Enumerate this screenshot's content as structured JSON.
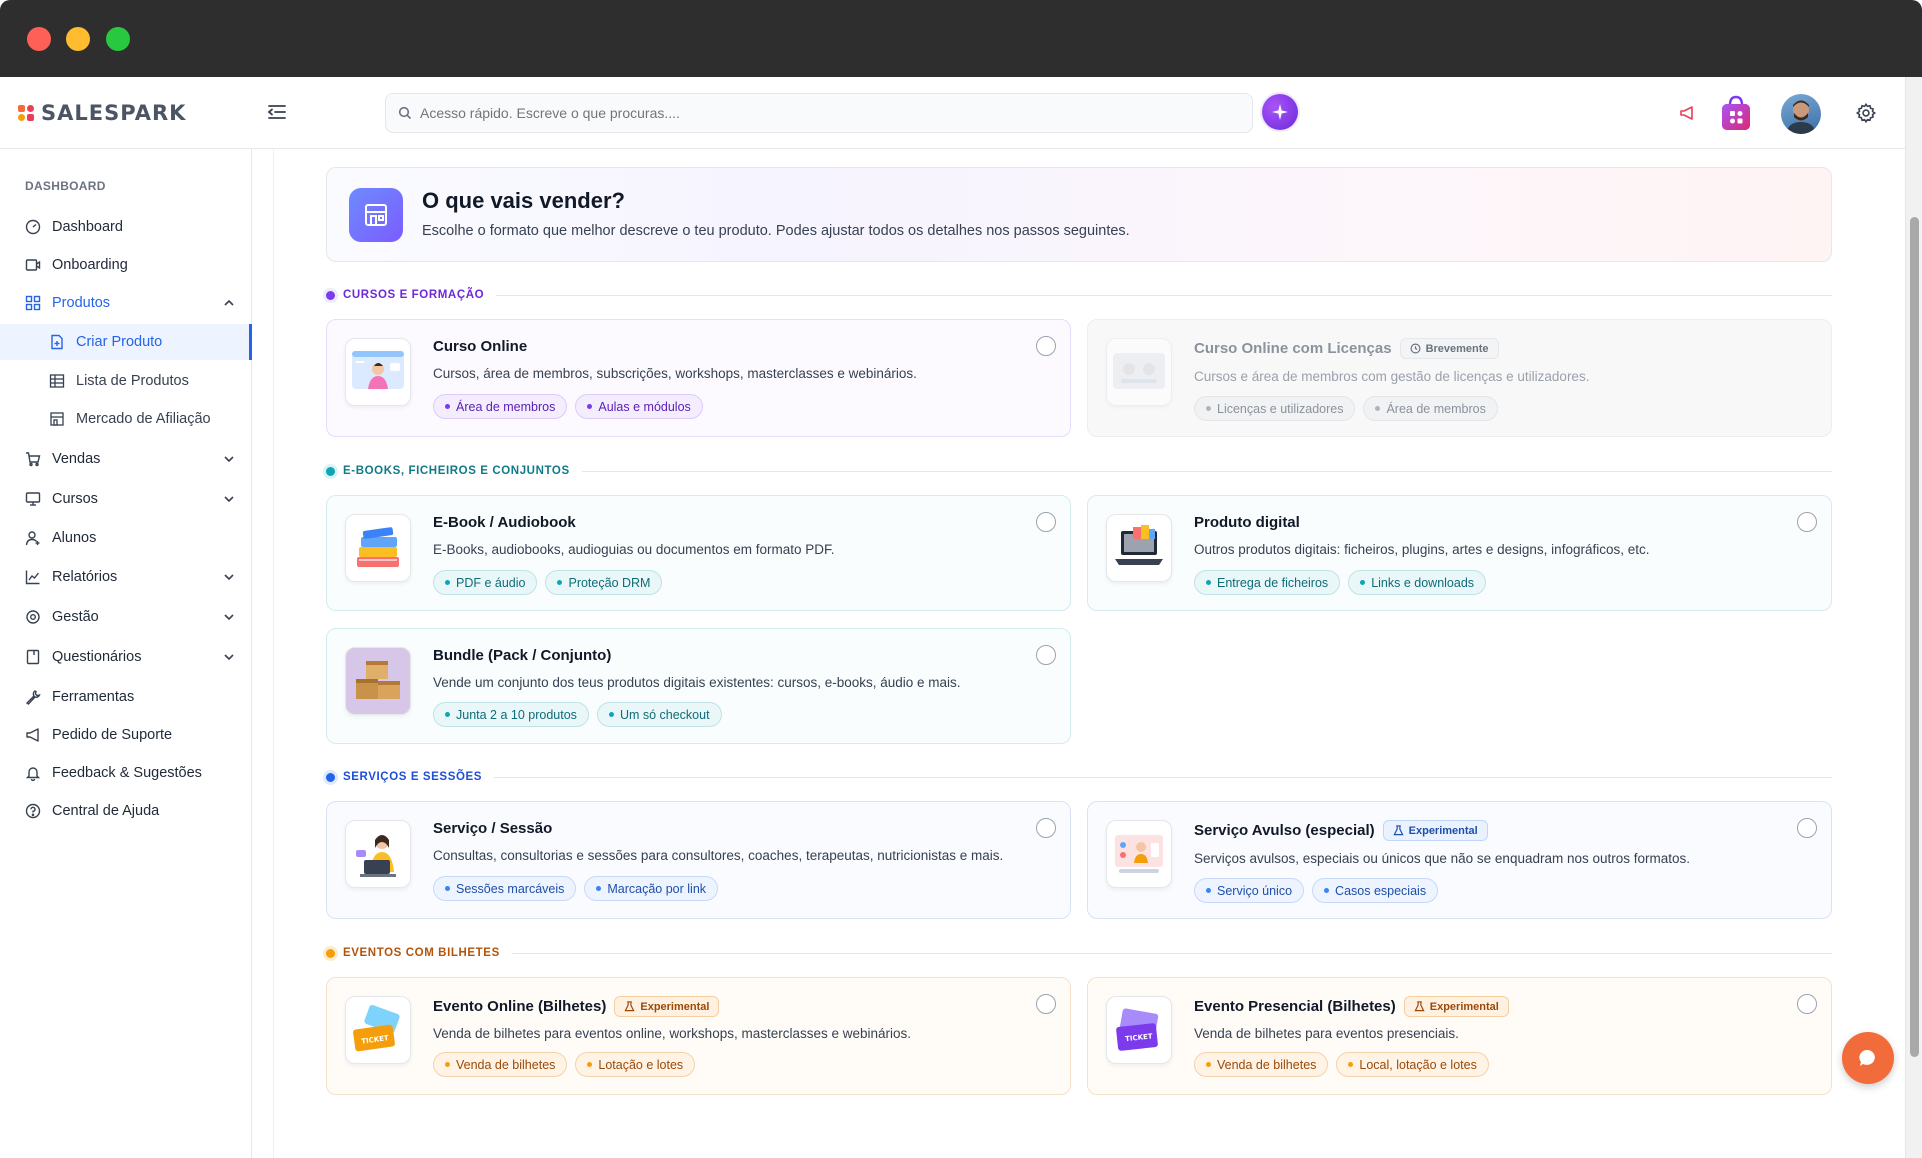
{
  "brand": {
    "name": "SALESPARK"
  },
  "search": {
    "placeholder": "Acesso rápido. Escreve o que procuras...."
  },
  "sidebar": {
    "section": "DASHBOARD",
    "items": [
      {
        "label": "Dashboard"
      },
      {
        "label": "Onboarding"
      },
      {
        "label": "Produtos"
      },
      {
        "label": "Criar Produto"
      },
      {
        "label": "Lista de Produtos"
      },
      {
        "label": "Mercado de Afiliação"
      },
      {
        "label": "Vendas"
      },
      {
        "label": "Cursos"
      },
      {
        "label": "Alunos"
      },
      {
        "label": "Relatórios"
      },
      {
        "label": "Gestão"
      },
      {
        "label": "Questionários"
      },
      {
        "label": "Ferramentas"
      },
      {
        "label": "Pedido de Suporte"
      },
      {
        "label": "Feedback & Sugestões"
      },
      {
        "label": "Central de Ajuda"
      }
    ]
  },
  "hero": {
    "title": "O que vais vender?",
    "subtitle": "Escolhe o formato que melhor descreve o teu produto. Podes ajustar todos os detalhes nos passos seguintes."
  },
  "groups": [
    {
      "title": "CURSOS E FORMAÇÃO",
      "color": "#7c3aed"
    },
    {
      "title": "E-BOOKS, FICHEIROS E CONJUNTOS",
      "color": "#0ea5b4"
    },
    {
      "title": "SERVIÇOS E SESSÕES",
      "color": "#2563eb"
    },
    {
      "title": "EVENTOS COM BILHETES",
      "color": "#f59e0b"
    }
  ],
  "cards": {
    "curso_online": {
      "title": "Curso Online",
      "desc": "Cursos, área de membros, subscrições, workshops, masterclasses e webinários.",
      "tags": [
        "Área de membros",
        "Aulas e módulos"
      ]
    },
    "curso_licencas": {
      "title": "Curso Online com Licenças",
      "badge": "Brevemente",
      "desc": "Cursos e área de membros com gestão de licenças e utilizadores.",
      "tags": [
        "Licenças e utilizadores",
        "Área de membros"
      ]
    },
    "ebook": {
      "title": "E-Book / Audiobook",
      "desc": "E-Books, audiobooks, audioguias ou documentos em formato PDF.",
      "tags": [
        "PDF e áudio",
        "Proteção DRM"
      ]
    },
    "produto_digital": {
      "title": "Produto digital",
      "desc": "Outros produtos digitais: ficheiros, plugins, artes e designs, infográficos, etc.",
      "tags": [
        "Entrega de ficheiros",
        "Links e downloads"
      ]
    },
    "bundle": {
      "title": "Bundle (Pack / Conjunto)",
      "desc": "Vende um conjunto dos teus produtos digitais existentes: cursos, e-books, áudio e mais.",
      "tags": [
        "Junta 2 a 10 produtos",
        "Um só checkout"
      ]
    },
    "servico": {
      "title": "Serviço / Sessão",
      "desc": "Consultas, consultorias e sessões para consultores, coaches, terapeutas, nutricionistas e mais.",
      "tags": [
        "Sessões marcáveis",
        "Marcação por link"
      ]
    },
    "servico_avulso": {
      "title": "Serviço Avulso (especial)",
      "badge": "Experimental",
      "desc": "Serviços avulsos, especiais ou únicos que não se enquadram nos outros formatos.",
      "tags": [
        "Serviço único",
        "Casos especiais"
      ]
    },
    "evento_online": {
      "title": "Evento Online (Bilhetes)",
      "badge": "Experimental",
      "desc": "Venda de bilhetes para eventos online, workshops, masterclasses e webinários.",
      "tags": [
        "Venda de bilhetes",
        "Lotação e lotes"
      ]
    },
    "evento_presencial": {
      "title": "Evento Presencial (Bilhetes)",
      "badge": "Experimental",
      "desc": "Venda de bilhetes para eventos presenciais.",
      "tags": [
        "Venda de bilhetes",
        "Local, lotação e lotes"
      ]
    }
  },
  "thumb_texts": {
    "ticket": "TICKET"
  }
}
